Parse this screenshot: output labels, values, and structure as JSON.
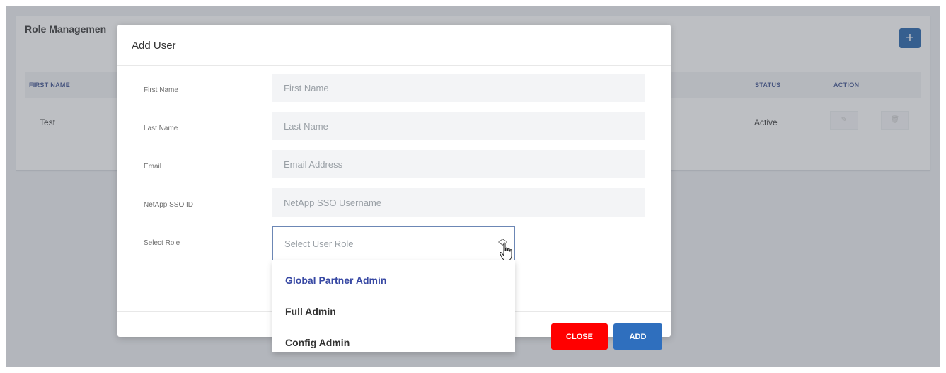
{
  "background": {
    "title": "Role Managemen",
    "add_icon": "+",
    "columns": [
      "FIRST NAME",
      "STATUS",
      "ACTION"
    ],
    "row": {
      "first_name": "Test",
      "status": "Active"
    },
    "action_icons": [
      "edit-icon",
      "trash-icon"
    ]
  },
  "modal": {
    "title": "Add User",
    "fields": [
      {
        "label": "First Name",
        "placeholder": "First Name"
      },
      {
        "label": "Last Name",
        "placeholder": "Last Name"
      },
      {
        "label": "Email",
        "placeholder": "Email Address"
      },
      {
        "label": "NetApp SSO ID",
        "placeholder": "NetApp SSO Username"
      }
    ],
    "role": {
      "label": "Select Role",
      "placeholder": "Select User Role",
      "options": [
        "Global Partner Admin",
        "Full Admin",
        "Config Admin"
      ],
      "highlighted": "Global Partner Admin"
    },
    "buttons": {
      "close": "CLOSE",
      "add": "ADD"
    }
  },
  "colors": {
    "close_button": "#ff0000",
    "add_button": "#2f6fbe",
    "header_text": "#3a4e8c",
    "highlight_option": "#3748a3"
  }
}
